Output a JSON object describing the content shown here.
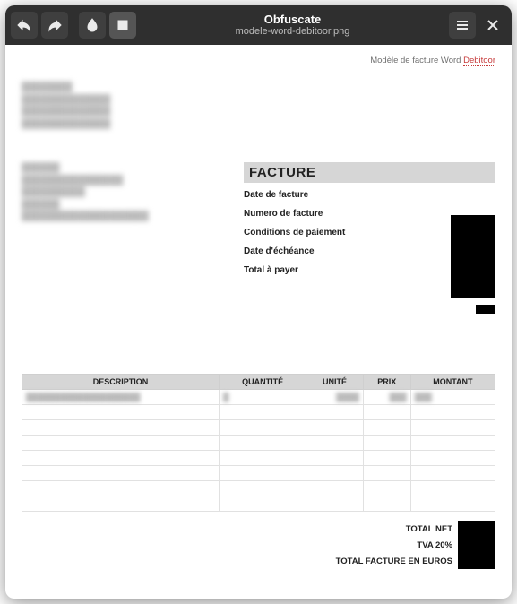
{
  "titlebar": {
    "app_name": "Obfuscate",
    "subtitle": "modele-word-debitoor.png"
  },
  "page": {
    "top_note_prefix": "Modèle de facture Word ",
    "top_note_brand": "Debitoor"
  },
  "invoice": {
    "heading": "FACTURE",
    "fields": {
      "date": "Date de facture",
      "number": "Numero de facture",
      "terms": "Conditions de paiement",
      "due": "Date d'échéance",
      "total_due": "Total à payer"
    }
  },
  "table": {
    "cols": {
      "desc": "DESCRIPTION",
      "qty": "QUANTITÉ",
      "unit": "UNITÉ",
      "price": "PRIX",
      "amount": "MONTANT"
    }
  },
  "totals": {
    "net": "TOTAL NET",
    "vat": "TVA 20%",
    "grand": "TOTAL FACTURE EN EUROS"
  }
}
